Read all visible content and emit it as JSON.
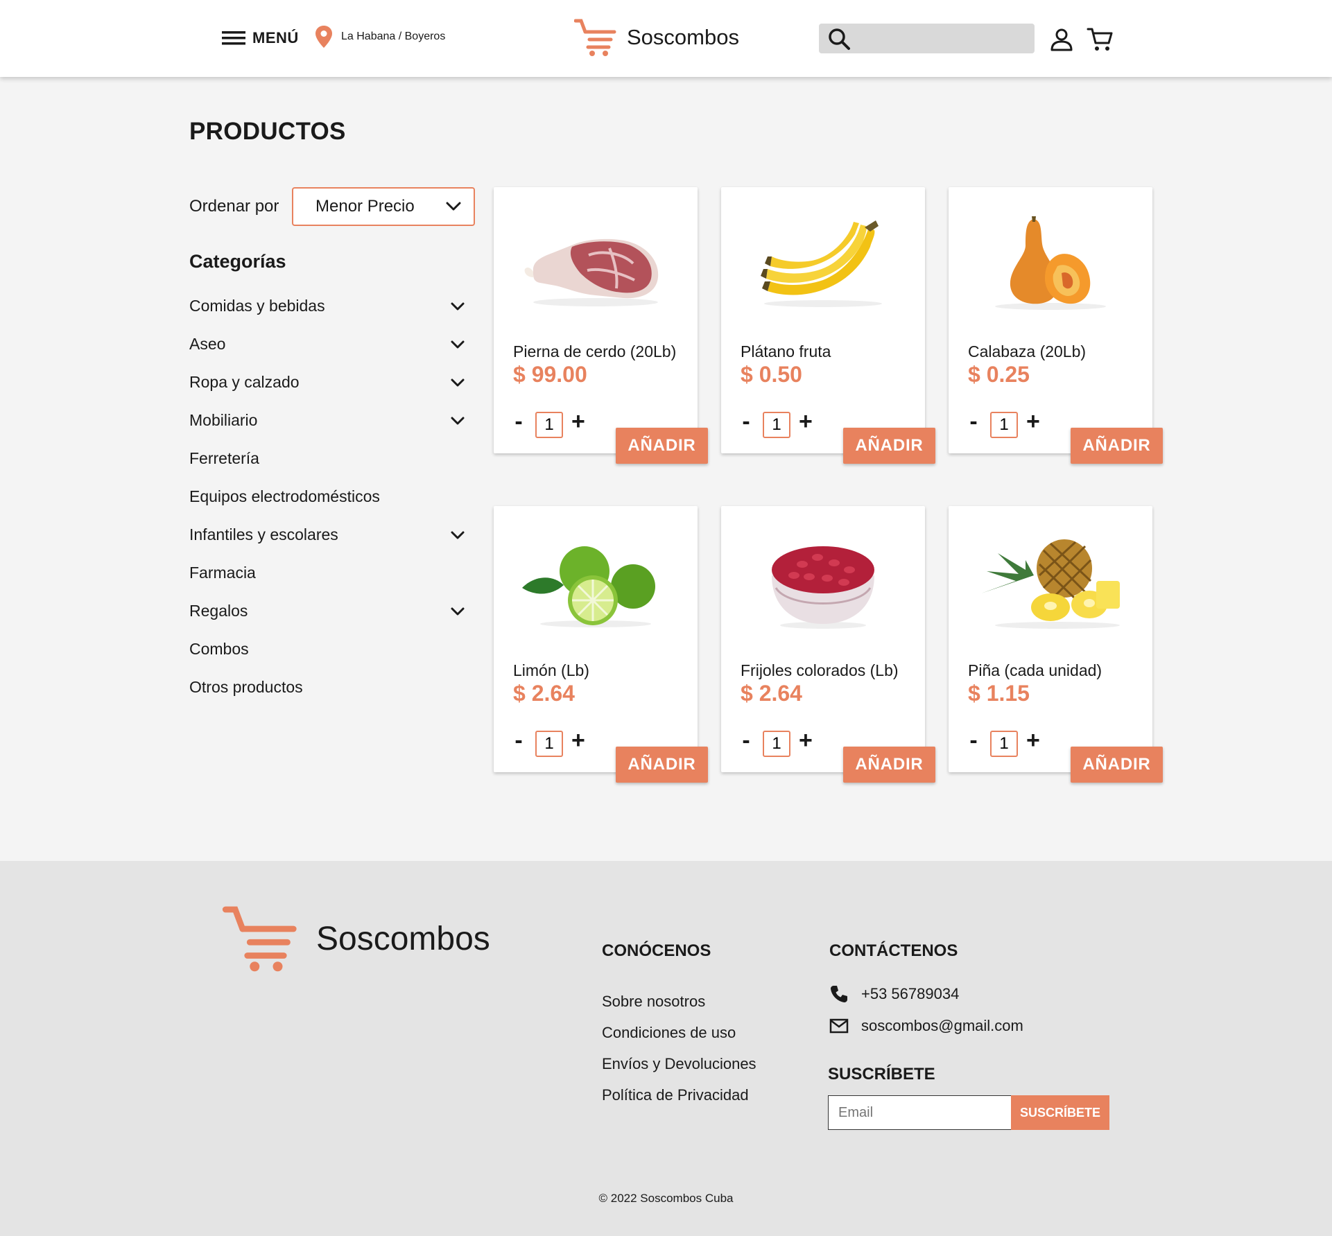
{
  "header": {
    "menu_label": "MENÚ",
    "location": "La Habana / Boyeros",
    "brand": "Soscombos",
    "search_placeholder": ""
  },
  "main": {
    "title": "PRODUCTOS",
    "sort_label": "Ordenar por",
    "sort_value": "Menor Precio"
  },
  "categories": {
    "title": "Categorías",
    "items": [
      {
        "label": "Comidas y bebidas",
        "expandable": true
      },
      {
        "label": "Aseo",
        "expandable": true
      },
      {
        "label": "Ropa y calzado",
        "expandable": true
      },
      {
        "label": "Mobiliario",
        "expandable": true
      },
      {
        "label": "Ferretería",
        "expandable": false
      },
      {
        "label": "Equipos electrodomésticos",
        "expandable": false
      },
      {
        "label": "Infantiles y escolares",
        "expandable": true
      },
      {
        "label": "Farmacia",
        "expandable": false
      },
      {
        "label": "Regalos",
        "expandable": true
      },
      {
        "label": "Combos",
        "expandable": false
      },
      {
        "label": "Otros productos",
        "expandable": false
      }
    ]
  },
  "products": [
    {
      "name": "Pierna de cerdo (20Lb)",
      "price": "$ 99.00",
      "qty": "1",
      "image": "pork-leg"
    },
    {
      "name": "Plátano fruta",
      "price": "$ 0.50",
      "qty": "1",
      "image": "banana"
    },
    {
      "name": "Calabaza (20Lb)",
      "price": "$ 0.25",
      "qty": "1",
      "image": "squash"
    },
    {
      "name": "Limón (Lb)",
      "price": "$ 2.64",
      "qty": "1",
      "image": "lime"
    },
    {
      "name": "Frijoles colorados (Lb)",
      "price": "$ 2.64",
      "qty": "1",
      "image": "red-beans"
    },
    {
      "name": "Piña (cada unidad)",
      "price": "$ 1.15",
      "qty": "1",
      "image": "pineapple"
    }
  ],
  "labels": {
    "minus": "-",
    "plus": "+",
    "add": "AÑADIR"
  },
  "footer": {
    "brand": "Soscombos",
    "about_title": "CONÓCENOS",
    "about_links": [
      "Sobre nosotros",
      "Condiciones de uso",
      "Envíos y Devoluciones",
      "Política de Privacidad"
    ],
    "contact_title": "CONTÁCTENOS",
    "phone": "+53 56789034",
    "email": "soscombos@gmail.com",
    "subscribe_title": "SUSCRÍBETE",
    "email_placeholder": "Email",
    "subscribe_button": "SUSCRÍBETE",
    "copyright": "© 2022 Soscombos Cuba"
  },
  "colors": {
    "accent": "#e8825e",
    "page_bg": "#f4f4f4",
    "footer_bg": "#e4e4e4",
    "search_bg": "#d9d9d9"
  }
}
